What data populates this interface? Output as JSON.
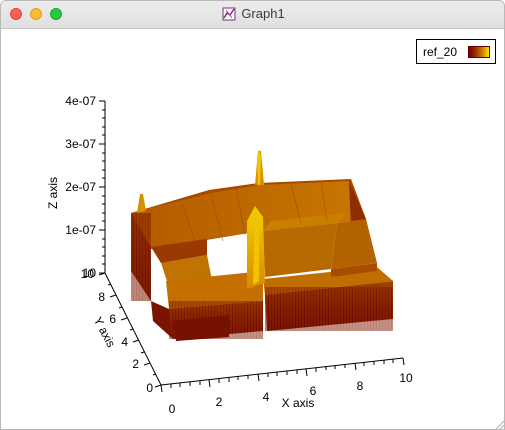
{
  "window": {
    "title": "Graph1",
    "title_icon": "graph-window-icon"
  },
  "legend": {
    "label": "ref_20",
    "colors": [
      "#6b0000",
      "#9a2a00",
      "#c46a00",
      "#e9b000",
      "#ffe800"
    ]
  },
  "chart_data": {
    "type": "surface",
    "z_axis": {
      "label": "Z axis",
      "ticks": [
        "10",
        "1e-07",
        "2e-07",
        "3e-07",
        "4e-07"
      ]
    },
    "y_axis": {
      "label": "Y axis",
      "ticks": [
        "0",
        "2",
        "4",
        "6",
        "8",
        "10"
      ]
    },
    "x_axis": {
      "label": "X axis",
      "ticks": [
        "0",
        "2",
        "4",
        "6",
        "8",
        "10"
      ]
    }
  }
}
